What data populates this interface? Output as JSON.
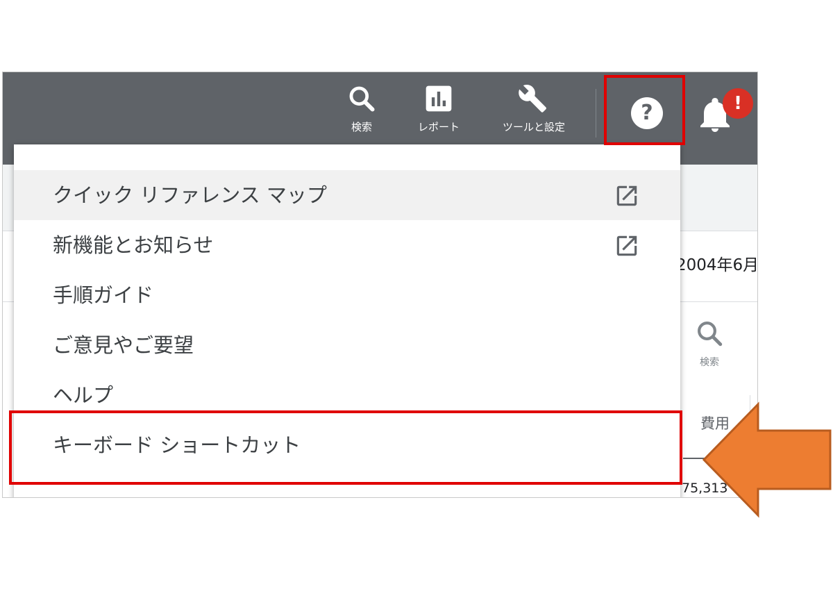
{
  "toolbar": {
    "search_label": "検索",
    "report_label": "レポート",
    "tools_label": "ツールと設定",
    "help_icon": "question-circle-icon",
    "notification_icon": "bell-icon",
    "notification_badge": "!"
  },
  "help_menu": {
    "items": [
      {
        "label": "クイック リファレンス マップ",
        "external": true
      },
      {
        "label": "新機能とお知らせ",
        "external": true
      },
      {
        "label": "手順ガイド",
        "external": false
      },
      {
        "label": "ご意見やご要望",
        "external": false
      },
      {
        "label": "ヘルプ",
        "external": false
      },
      {
        "label": "キーボード ショートカット",
        "external": false
      }
    ]
  },
  "background": {
    "date_text": "2004年6月",
    "search_label": "検索",
    "cost_header": "費用",
    "cost_value": "75,313"
  },
  "annotations": {
    "highlight_color": "#e00000",
    "arrow_color": "#ed7d31"
  }
}
